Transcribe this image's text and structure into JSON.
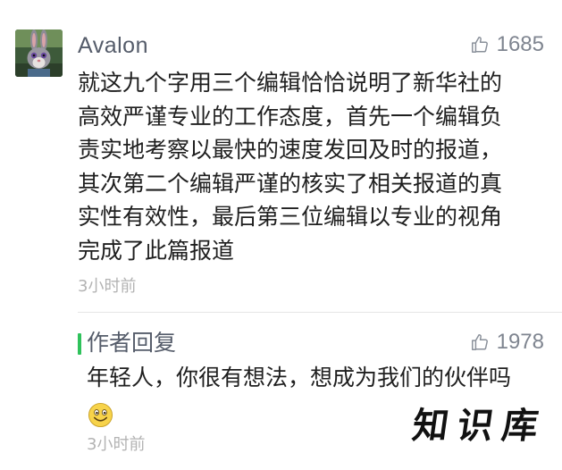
{
  "comment": {
    "username": "Avalon",
    "likes": "1685",
    "lines": [
      "就这九个字用三个编辑恰恰说明了新华社的",
      "高效严谨专业的工作态度，首先一个编辑负",
      "责实地考察以最快的速度发回及时的报道，",
      "其次第二个编辑严谨的核实了相关报道的真",
      "实性有效性，最后第三位编辑以专业的视角",
      "完成了此篇报道"
    ],
    "time": "3小时前",
    "avatar_icon": "bunny-avatar"
  },
  "reply": {
    "label": "作者回复",
    "likes": "1978",
    "text": "年轻人，你很有想法，想成为我们的伙伴吗",
    "emoji_icon": "smiley-emoji",
    "time": "3小时前",
    "accent_color": "#2fc25b"
  },
  "watermark": {
    "text": "知识库"
  }
}
